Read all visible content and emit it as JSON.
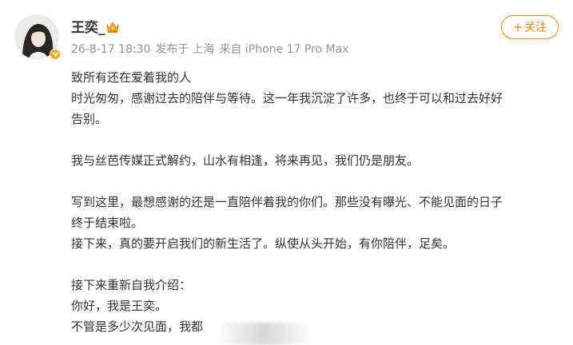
{
  "post": {
    "author": {
      "name": "王奕_",
      "avatar_icon": "avatar-photo",
      "verified_icon": "verified-badge-icon",
      "vip_icon": "vip-crown-icon"
    },
    "meta": {
      "date": "26-8-17 18:30",
      "source_prefix": "发布于",
      "location": "上海",
      "device": "来自 iPhone 17 Pro Max"
    },
    "follow_button": {
      "plus": "+",
      "label": "关注"
    },
    "lines": [
      "致所有还在爱着我的人",
      "时光匆匆，感谢过去的陪伴与等待。这一年我沉淀了许多，也终于可以和过去好好",
      "告别。",
      "",
      "我与丝芭传媒正式解约，山水有相逢，将来再见，我们仍是朋友。",
      "",
      "写到这里，最想感谢的还是一直陪伴着我的你们。那些没有曝光、不能见面的日子",
      "终于结束啦。",
      "接下来，真的要开启我们的新生活了。纵使从头开始，有你陪伴，足矣。",
      "",
      "接下来重新自我介绍：",
      "你好，我是王奕。",
      "不管是多少次见面，我都"
    ]
  },
  "colors": {
    "accent": "#ff8200",
    "text": "#333333",
    "meta": "#939393",
    "badge": "#f5a623"
  }
}
